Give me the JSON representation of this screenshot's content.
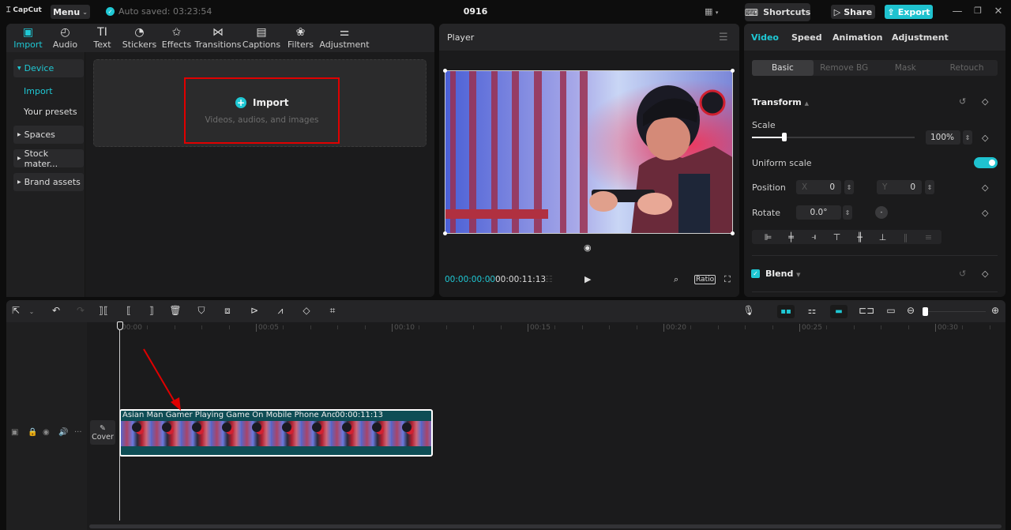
{
  "titlebar": {
    "app_name": "CapCut",
    "menu_label": "Menu",
    "autosave_text": "Auto saved: 03:23:54",
    "project_title": "0916",
    "shortcuts_label": "Shortcuts",
    "share_label": "Share",
    "export_label": "Export"
  },
  "media_toolbar": [
    {
      "label": "Import",
      "icon": "import-icon",
      "glyph": "▣",
      "active": true
    },
    {
      "label": "Audio",
      "icon": "audio-icon",
      "glyph": "◴"
    },
    {
      "label": "Text",
      "icon": "text-icon",
      "glyph": "TI"
    },
    {
      "label": "Stickers",
      "icon": "stickers-icon",
      "glyph": "◔"
    },
    {
      "label": "Effects",
      "icon": "effects-icon",
      "glyph": "✩"
    },
    {
      "label": "Transitions",
      "icon": "transitions-icon",
      "glyph": "⋈"
    },
    {
      "label": "Captions",
      "icon": "captions-icon",
      "glyph": "▤"
    },
    {
      "label": "Filters",
      "icon": "filters-icon",
      "glyph": "❀"
    },
    {
      "label": "Adjustment",
      "icon": "adjustment-icon",
      "glyph": "⚌"
    }
  ],
  "side_nav": {
    "device": "Device",
    "import": "Import",
    "presets": "Your presets",
    "spaces": "Spaces",
    "stock": "Stock mater...",
    "brand": "Brand assets"
  },
  "import_area": {
    "title": "Import",
    "subtitle": "Videos, audios, and images"
  },
  "player": {
    "title": "Player",
    "current_time": "00:00:00:00",
    "separator": "/",
    "total_time": "00:00:11:13",
    "ratio_label": "Ratio"
  },
  "props": {
    "tabs": [
      "Video",
      "Speed",
      "Animation",
      "Adjustment"
    ],
    "subtabs": [
      "Basic",
      "Remove BG",
      "Mask",
      "Retouch"
    ],
    "transform_label": "Transform",
    "scale_label": "Scale",
    "scale_value": "100%",
    "scale_slider_fraction": 0.2,
    "uniform_scale_label": "Uniform scale",
    "uniform_scale_on": true,
    "position_label": "Position",
    "x_label": "X",
    "x_value": "0",
    "y_label": "Y",
    "y_value": "0",
    "rotate_label": "Rotate",
    "rotate_value": "0.0°",
    "blend_label": "Blend",
    "blend_checked": true
  },
  "timeline": {
    "ruler": [
      "00:00",
      "00:05",
      "00:10",
      "00:15",
      "00:20",
      "00:25",
      "00:30"
    ],
    "clip_title": "Asian Man Gamer Playing Game On Mobile Phone And Win",
    "clip_duration": "00:00:11:13",
    "cover_label": "Cover"
  },
  "colors": {
    "accent": "#1fc8d4",
    "annotation": "#e00000"
  }
}
